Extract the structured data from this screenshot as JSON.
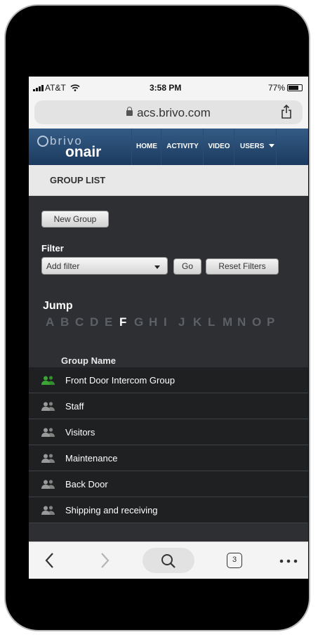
{
  "status_bar": {
    "carrier": "AT&T",
    "time": "3:58 PM",
    "battery": "77%"
  },
  "browser": {
    "url": "acs.brivo.com",
    "tab_count": "3"
  },
  "brand": {
    "logo_top": "brivo",
    "logo_bottom": "onair"
  },
  "nav": {
    "items": [
      "HOME",
      "ACTIVITY",
      "VIDEO",
      "USERS"
    ]
  },
  "page": {
    "title": "GROUP LIST",
    "new_group_label": "New Group",
    "filter_label": "Filter",
    "filter_select": "Add filter",
    "go_label": "Go",
    "reset_label": "Reset Filters",
    "jump_label": "Jump",
    "jump_letters": [
      "A",
      "B",
      "C",
      "D",
      "E",
      "F",
      "G",
      "H",
      "I",
      "J",
      "K",
      "L",
      "M",
      "N",
      "O",
      "P"
    ],
    "jump_active": "F",
    "column_header": "Group Name"
  },
  "groups": [
    {
      "name": "Front Door Intercom Group",
      "icon_color": "#3aa635"
    },
    {
      "name": "Staff",
      "icon_color": "#9a9a9a"
    },
    {
      "name": "Visitors",
      "icon_color": "#9a9a9a"
    },
    {
      "name": "Maintenance",
      "icon_color": "#9a9a9a"
    },
    {
      "name": "Back Door",
      "icon_color": "#9a9a9a"
    },
    {
      "name": "Shipping and receiving",
      "icon_color": "#9a9a9a"
    }
  ]
}
